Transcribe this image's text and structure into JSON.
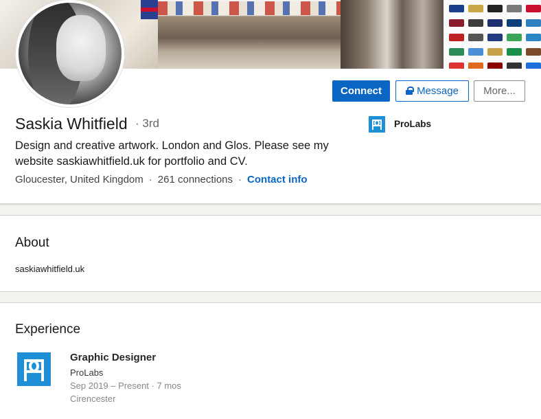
{
  "profile": {
    "name": "Saskia Whitfield",
    "degree": "· 3rd",
    "headline": "Design and creative artwork. London and Glos. Please see my website saskiawhitfield.uk for portfolio and CV.",
    "location": "Gloucester, United Kingdom",
    "connections": "261 connections",
    "contact_info": "Contact info",
    "separator": "·",
    "current_company": "ProLabs"
  },
  "actions": {
    "connect": "Connect",
    "message": "Message",
    "more": "More..."
  },
  "about": {
    "title": "About",
    "text": "saskiawhitfield.uk"
  },
  "experience": {
    "title": "Experience",
    "items": [
      {
        "title": "Graphic Designer",
        "company": "ProLabs",
        "dates": "Sep 2019 – Present · 7 mos",
        "location": "Cirencester"
      }
    ]
  },
  "colors": {
    "brand_blue": "#0a66c2",
    "prolabs_blue": "#1f8fd6"
  }
}
